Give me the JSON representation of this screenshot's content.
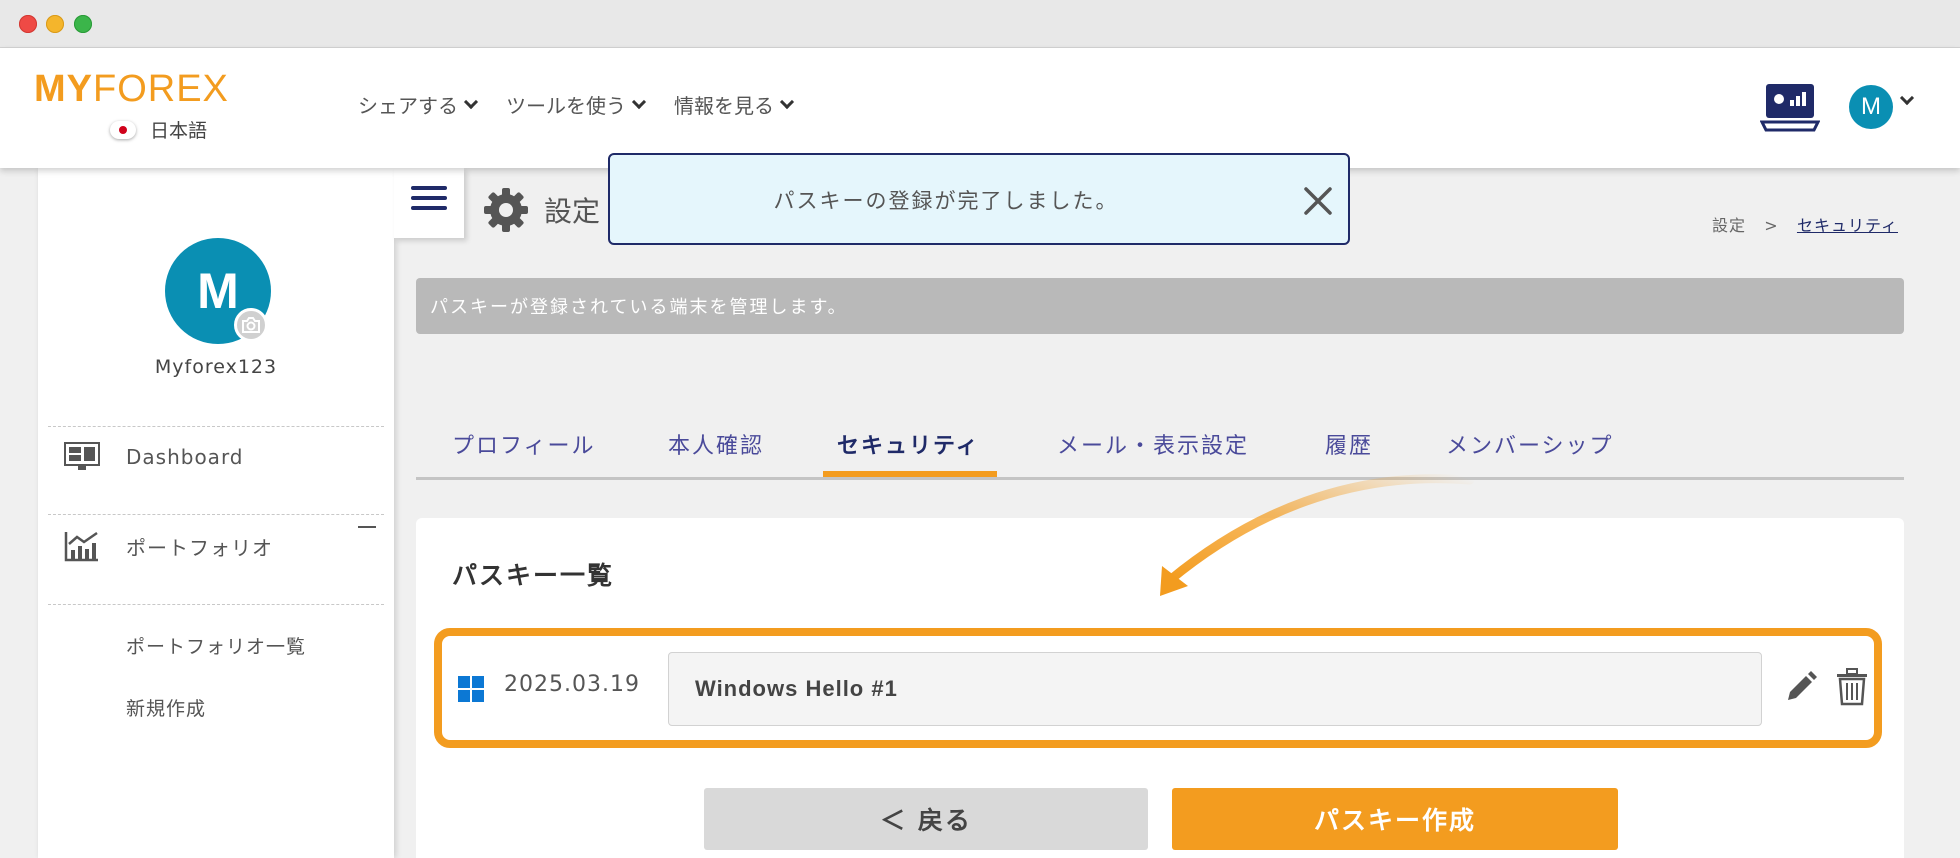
{
  "header": {
    "logo_my": "MY",
    "logo_forex": "FOREX",
    "language": "日本語",
    "nav": [
      "シェアする",
      "ツールを使う",
      "情報を見る"
    ],
    "avatar_initial": "M"
  },
  "sidebar": {
    "avatar_initial": "M",
    "username": "Myforex123",
    "items": [
      {
        "label": "Dashboard",
        "icon": "dashboard-icon"
      },
      {
        "label": "ポートフォリオ",
        "icon": "chart-icon"
      }
    ],
    "subitems": [
      "ポートフォリオ一覧",
      "新規作成"
    ]
  },
  "page": {
    "title": "設定",
    "breadcrumb_root": "設定",
    "breadcrumb_sep": ">",
    "breadcrumb_current": "セキュリティ",
    "info": "パスキーが登録されている端末を管理します。"
  },
  "tabs": [
    "プロフィール",
    "本人確認",
    "セキュリティ",
    "メール・表示設定",
    "履歴",
    "メンバーシップ"
  ],
  "active_tab": "セキュリティ",
  "card": {
    "title": "パスキー一覧",
    "passkey": {
      "date": "2025.03.19",
      "name": "Windows Hello #1",
      "icon": "windows-icon"
    },
    "back_label": "＜ 戻る",
    "create_label": "パスキー作成"
  },
  "toast": {
    "message": "パスキーの登録が完了しました。"
  },
  "colors": {
    "accent": "#f39c1f",
    "navy": "#1f2a68",
    "avatar": "#0a8fb3",
    "toast_bg": "#e5f6fc"
  }
}
